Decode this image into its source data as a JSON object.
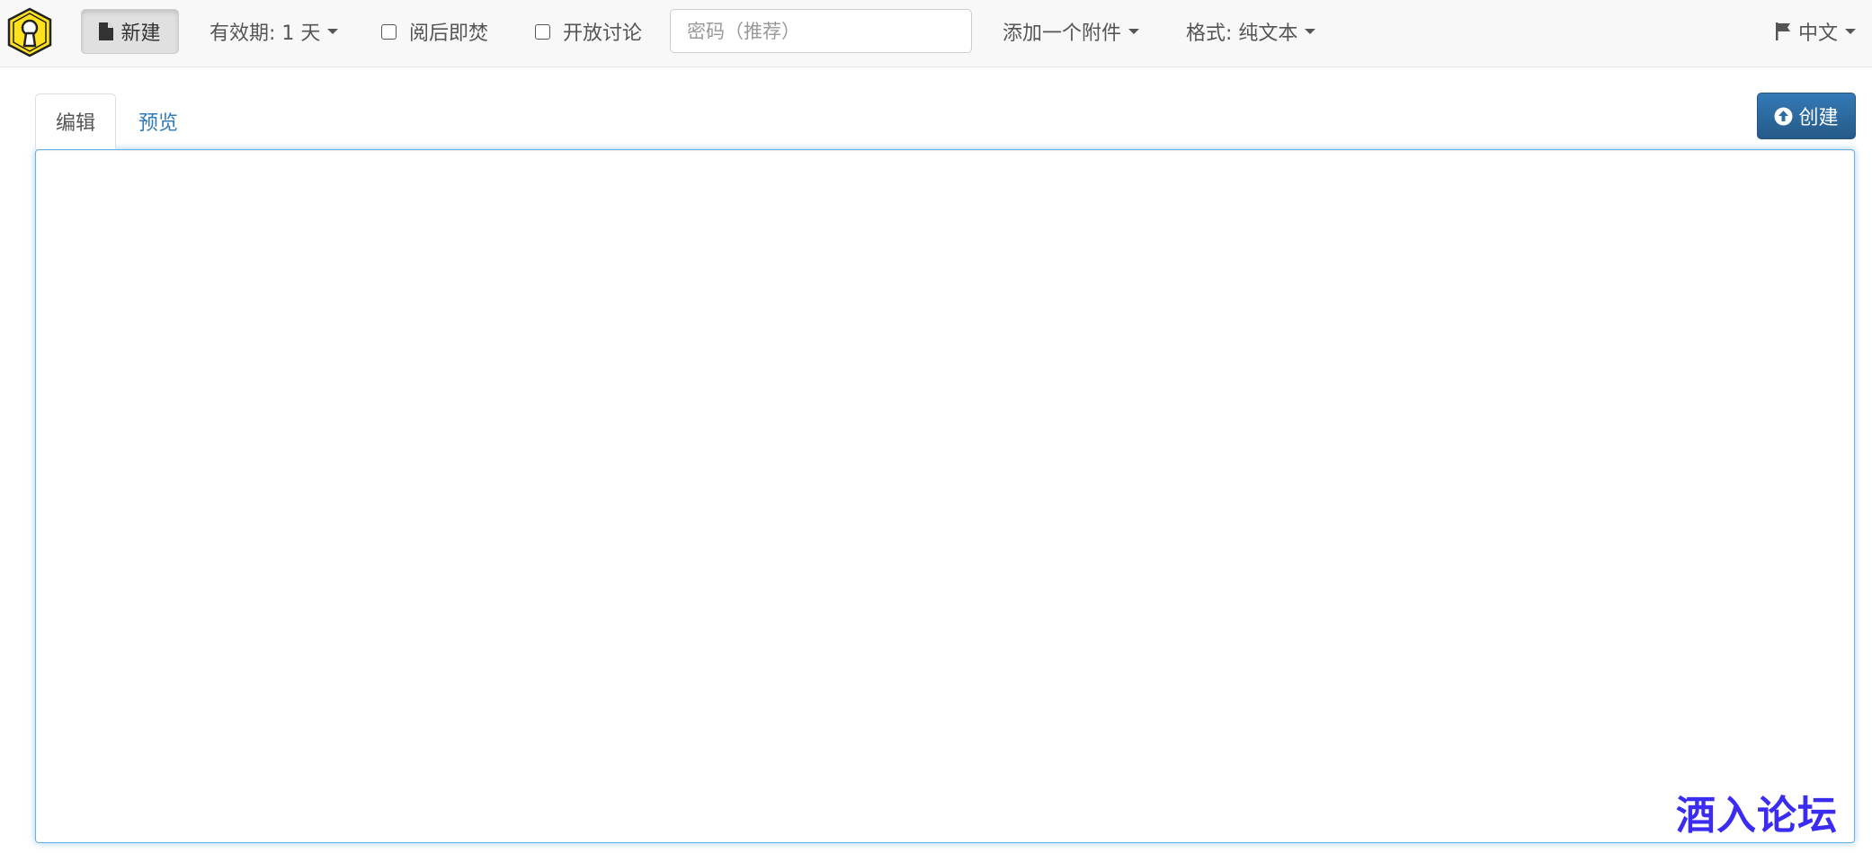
{
  "toolbar": {
    "new_label": "新建",
    "expiry_label": "有效期: 1 天",
    "burn_label": "阅后即焚",
    "discussion_label": "开放讨论",
    "password_placeholder": "密码（推荐）",
    "attachment_label": "添加一个附件",
    "format_label": "格式: 纯文本",
    "language_label": "中文"
  },
  "tabs": {
    "edit_label": "编辑",
    "preview_label": "预览"
  },
  "actions": {
    "create_label": "创建"
  },
  "editor": {
    "value": ""
  },
  "watermark": {
    "text": "酒入论坛"
  },
  "icons": {
    "logo": "keyhole-logo-icon",
    "new": "file-icon",
    "language": "flag-icon",
    "create": "circle-arrow-up-icon"
  },
  "colors": {
    "primary": "#337ab7",
    "logo_yellow": "#ffe11e",
    "watermark": "#3a2cf0"
  }
}
